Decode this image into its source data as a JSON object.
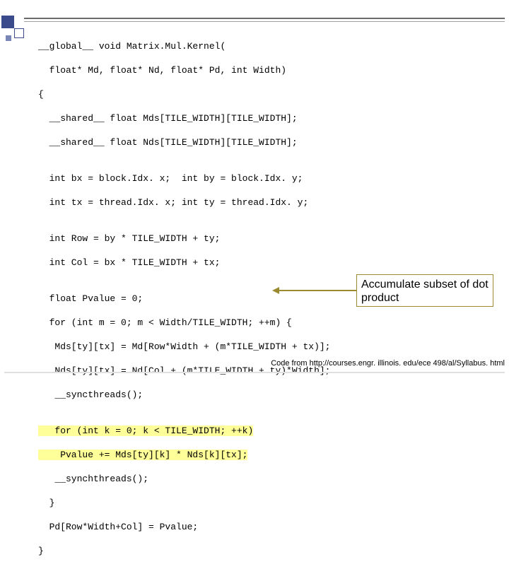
{
  "code": {
    "l01": "__global__ void Matrix.Mul.Kernel(",
    "l02": "  float* Md, float* Nd, float* Pd, int Width)",
    "l03": "{",
    "l04": "  __shared__ float Mds[TILE_WIDTH][TILE_WIDTH];",
    "l05": "  __shared__ float Nds[TILE_WIDTH][TILE_WIDTH];",
    "l06": "",
    "l07": "  int bx = block.Idx. x;  int by = block.Idx. y;",
    "l08": "  int tx = thread.Idx. x; int ty = thread.Idx. y;",
    "l09": "",
    "l10": "  int Row = by * TILE_WIDTH + ty;",
    "l11": "  int Col = bx * TILE_WIDTH + tx;",
    "l12": "",
    "l13": "  float Pvalue = 0;",
    "l14": "  for (int m = 0; m < Width/TILE_WIDTH; ++m) {",
    "l15": "   Mds[ty][tx] = Md[Row*Width + (m*TILE_WIDTH + tx)];",
    "l16": "   Nds[ty][tx] = Nd[Col + (m*TILE_WIDTH + ty)*Width];",
    "l17": "   __syncthreads();",
    "l18": "",
    "l19": "   for (int k = 0; k < TILE_WIDTH; ++k)",
    "l20": "    Pvalue += Mds[ty][k] * Nds[k][tx];",
    "l21": "   __synchthreads();",
    "l22": "  }",
    "l23": "  Pd[Row*Width+Col] = Pvalue;",
    "l24": "}"
  },
  "annotation": {
    "text": "Accumulate subset of dot product"
  },
  "footer": {
    "text": "Code from http://courses.engr. illinois. edu/ece 498/al/Syllabus. html"
  }
}
